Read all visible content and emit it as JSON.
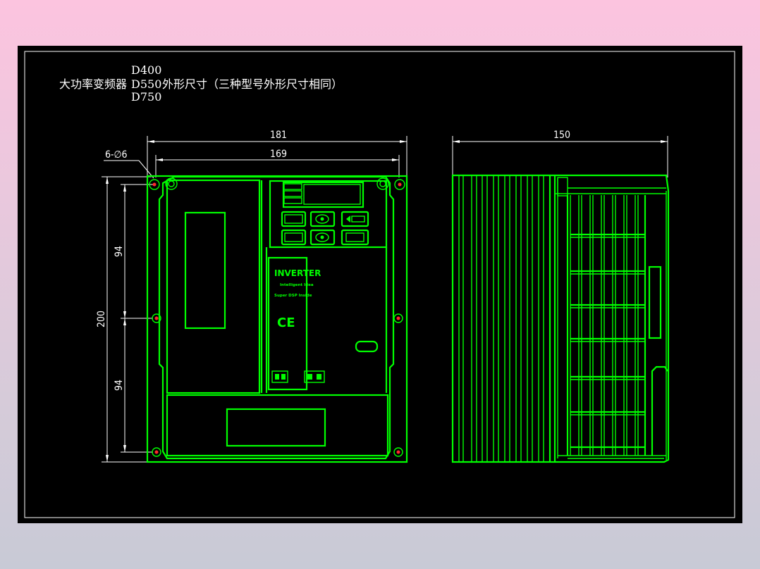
{
  "title": {
    "prefix": "大功率变频器",
    "models": [
      "D400",
      "D550",
      "D750"
    ],
    "suffix": "外形尺寸（三种型号外形尺寸相同）"
  },
  "dimensions": {
    "overall_width": "181",
    "hole_spacing_width": "169",
    "hole_spec": "6-∅6",
    "overall_height": "200",
    "upper_spacing": "94",
    "lower_spacing": "94",
    "side_depth": "150"
  },
  "panel_labels": {
    "brand": "INVERTER",
    "line1": "Intelligent Idea",
    "line2": "Super DSP Inside",
    "ce_mark": "CE"
  },
  "colors": {
    "drawing_line": "#00ff00",
    "dimension_line": "#ffffff",
    "background": "#000000"
  }
}
